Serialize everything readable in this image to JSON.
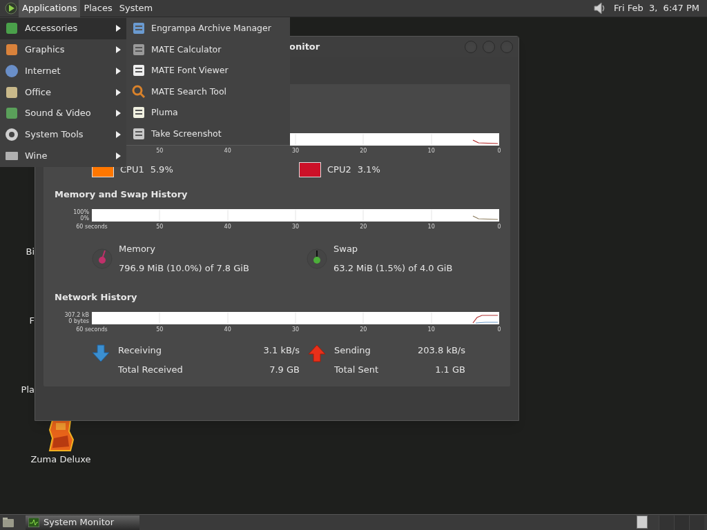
{
  "top_panel": {
    "menus": [
      {
        "label": "Applications",
        "selected": true
      },
      {
        "label": "Places",
        "selected": false
      },
      {
        "label": "System",
        "selected": false
      }
    ],
    "clock": "Fri Feb  3,  6:47 PM"
  },
  "desktop_icons": [
    {
      "label": "Bi",
      "kind": "hidden"
    },
    {
      "label": "F",
      "kind": "hidden"
    },
    {
      "label": "Pla",
      "kind": "hidden"
    },
    {
      "label": "Zuma Deluxe",
      "kind": "game"
    }
  ],
  "window": {
    "title": "onitor",
    "cpu": {
      "x_labels": [
        "50",
        "40",
        "30",
        "20",
        "10",
        "0"
      ],
      "legend": [
        {
          "name": "CPU1",
          "value": "5.9%",
          "color": "#ff7700"
        },
        {
          "name": "CPU2",
          "value": "3.1%",
          "color": "#cc1128"
        }
      ]
    },
    "memory": {
      "title": "Memory and Swap History",
      "y_labels": [
        "100%",
        "0%"
      ],
      "x_labels": [
        "60 seconds",
        "50",
        "40",
        "30",
        "20",
        "10",
        "0"
      ],
      "legend": [
        {
          "name": "Memory",
          "value": "796.9 MiB (10.0%) of 7.8 GiB",
          "color": "#c0306a"
        },
        {
          "name": "Swap",
          "value": "63.2 MiB (1.5%) of 4.0 GiB",
          "color": "#4caf3a"
        }
      ]
    },
    "network": {
      "title": "Network History",
      "y_labels": [
        "307.2 kB",
        "0 bytes"
      ],
      "x_labels": [
        "60 seconds",
        "50",
        "40",
        "30",
        "20",
        "10",
        "0"
      ],
      "stats": [
        {
          "kind": "receive",
          "label": "Receiving",
          "value": "3.1 kB/s",
          "total_label": "Total Received",
          "total": "7.9 GB"
        },
        {
          "kind": "send",
          "label": "Sending",
          "value": "203.8 kB/s",
          "total_label": "Total Sent",
          "total": "1.1 GB"
        }
      ]
    }
  },
  "applications_menu": {
    "categories": [
      {
        "label": "Accessories",
        "selected": true
      },
      {
        "label": "Graphics",
        "selected": false
      },
      {
        "label": "Internet",
        "selected": false
      },
      {
        "label": "Office",
        "selected": false
      },
      {
        "label": "Sound & Video",
        "selected": false
      },
      {
        "label": "System Tools",
        "selected": false
      },
      {
        "label": "Wine",
        "selected": false
      }
    ],
    "submenu": [
      "Engrampa Archive Manager",
      "MATE Calculator",
      "MATE Font Viewer",
      "MATE Search Tool",
      "Pluma",
      "Take Screenshot"
    ]
  },
  "taskbar": {
    "tasks": [
      {
        "label": "System Monitor",
        "selected": true
      }
    ]
  }
}
